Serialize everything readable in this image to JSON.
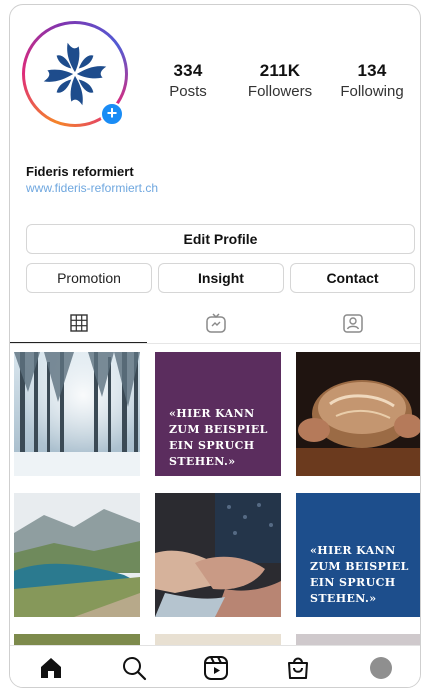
{
  "profile": {
    "name": "Fideris reformiert",
    "link": "www.fideris-reformiert.ch",
    "add_badge": "+"
  },
  "stats": [
    {
      "value": "334",
      "label": "Posts"
    },
    {
      "value": "211K",
      "label": "Followers"
    },
    {
      "value": "134",
      "label": "Following"
    }
  ],
  "buttons": {
    "edit_profile": "Edit Profile",
    "promotion": "Promotion",
    "insight": "Insight",
    "contact": "Contact"
  },
  "tabs": [
    {
      "icon": "grid-icon",
      "active": true
    },
    {
      "icon": "igtv-icon",
      "active": false
    },
    {
      "icon": "tagged-icon",
      "active": false
    }
  ],
  "posts": {
    "quote_1": "«HIER KANN\nZUM BEISPIEL\nEIN SPRUCH\nSTEHEN.»",
    "quote_2": "«HIER KANN\nZUM BEISPIEL\nEIN SPRUCH\nSTEHEN.»"
  },
  "colors": {
    "logo_blue": "#1e4c8c",
    "quote_purple": "#5b2d5e",
    "quote_blue": "#1d4e8c",
    "badge_blue": "#1a8cf5",
    "link_blue": "#6fa7df"
  },
  "bottom_nav": [
    "home-icon",
    "search-icon",
    "reels-icon",
    "shop-icon",
    "profile-avatar"
  ]
}
